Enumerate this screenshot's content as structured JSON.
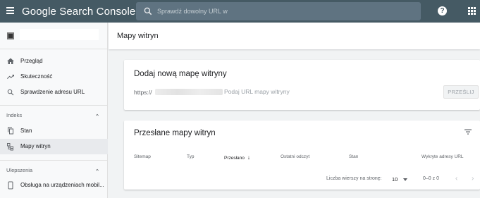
{
  "header": {
    "app_title": "Google Search Console",
    "search_placeholder": "Sprawdź dowolny URL w",
    "help_label": "?"
  },
  "sidebar": {
    "items": [
      {
        "label": "Przegląd",
        "icon": "home-icon"
      },
      {
        "label": "Skuteczność",
        "icon": "trending-up-icon"
      },
      {
        "label": "Sprawdzenie adresu URL",
        "icon": "search-icon"
      }
    ],
    "sections": [
      {
        "label": "Indeks",
        "items": [
          {
            "label": "Stan",
            "icon": "copy-icon"
          },
          {
            "label": "Mapy witryn",
            "icon": "sitemap-icon",
            "active": true
          }
        ]
      },
      {
        "label": "Ulepszenia",
        "items": [
          {
            "label": "Obsługa na urządzeniach mobil...",
            "icon": "smartphone-icon"
          }
        ]
      }
    ]
  },
  "main": {
    "page_title": "Mapy witryn",
    "add_card": {
      "title": "Dodaj nową mapę witryny",
      "url_prefix": "https://",
      "input_placeholder": "Podaj URL mapy witryny",
      "submit_label": "PRZEŚLIJ"
    },
    "submitted_card": {
      "title": "Przesłane mapy witryn",
      "columns": [
        "Sitemap",
        "Typ",
        "Przesłano",
        "Ostatni odczyt",
        "Stan",
        "Wykryte adresy URL"
      ],
      "sorted_column": "Przesłano",
      "rows_per_page_label": "Liczba wierszy na stronę:",
      "rows_per_page_value": "10",
      "range_label": "0–0 z 0",
      "prev_label": "‹",
      "next_label": "›"
    }
  },
  "colors": {
    "topbar": "#455a64",
    "accent": "#1a73e8"
  }
}
